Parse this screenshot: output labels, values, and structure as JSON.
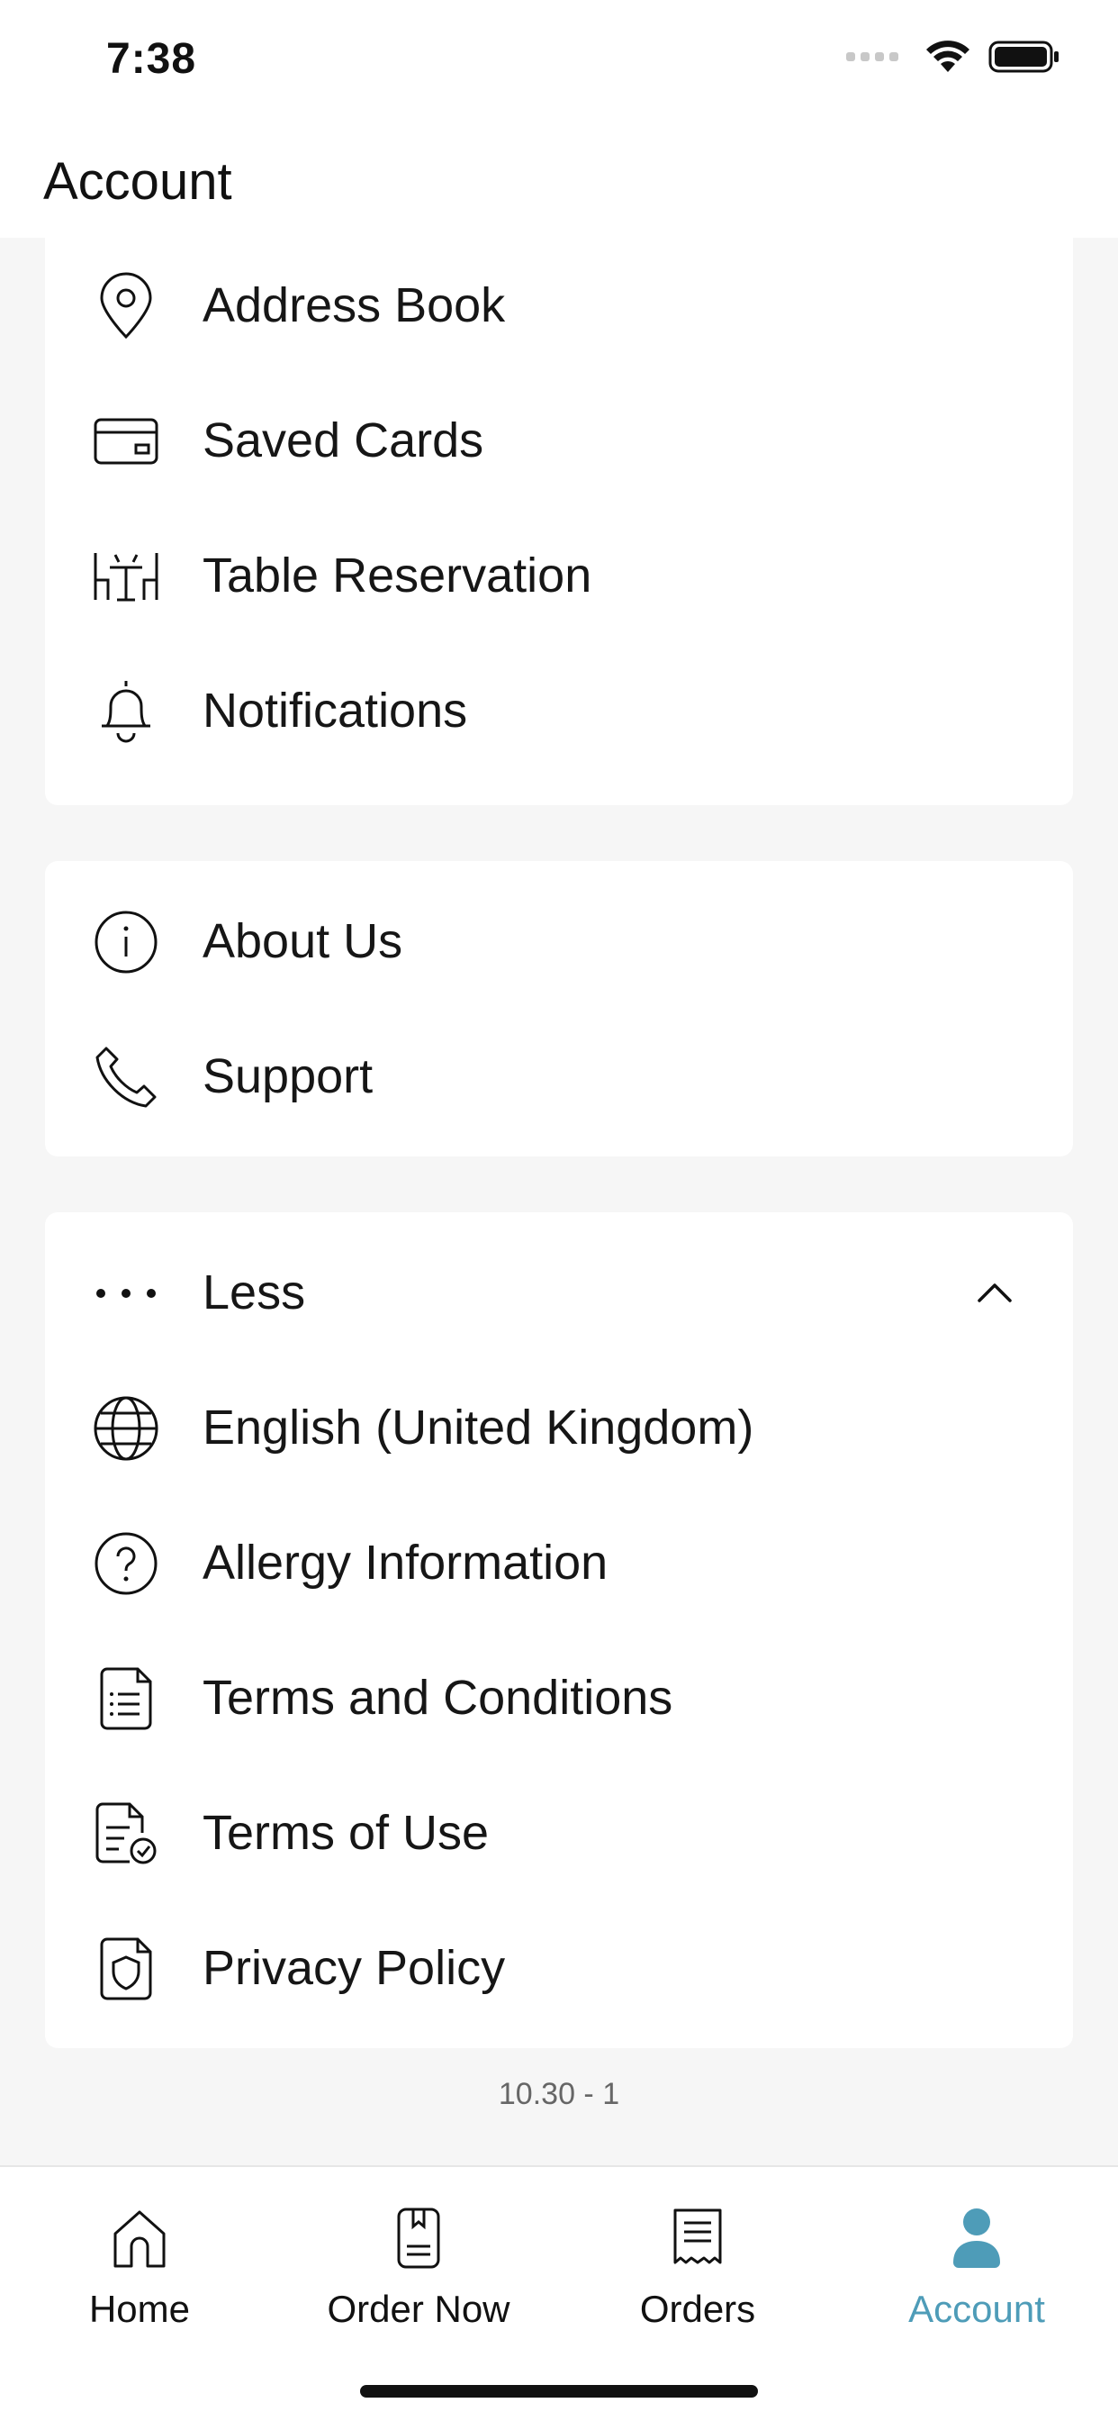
{
  "status_bar": {
    "time": "7:38"
  },
  "header": {
    "title": "Account"
  },
  "account_section": {
    "items": [
      {
        "label": "Address Book",
        "icon": "location-pin-icon"
      },
      {
        "label": "Saved Cards",
        "icon": "credit-card-icon"
      },
      {
        "label": "Table Reservation",
        "icon": "table-chairs-icon"
      },
      {
        "label": "Notifications",
        "icon": "bell-icon"
      }
    ]
  },
  "info_section": {
    "items": [
      {
        "label": "About Us",
        "icon": "info-icon"
      },
      {
        "label": "Support",
        "icon": "phone-icon"
      }
    ]
  },
  "more_section": {
    "toggle_label": "Less",
    "toggle_icon": "more-dots-icon",
    "items": [
      {
        "label": "English (United Kingdom)",
        "icon": "globe-icon"
      },
      {
        "label": "Allergy Information",
        "icon": "question-icon"
      },
      {
        "label": "Terms and Conditions",
        "icon": "document-list-icon"
      },
      {
        "label": "Terms of Use",
        "icon": "document-check-icon"
      },
      {
        "label": "Privacy Policy",
        "icon": "shield-document-icon"
      }
    ]
  },
  "version": "10.30 - 1",
  "tabbar": {
    "tabs": [
      {
        "label": "Home",
        "icon": "home-icon",
        "active": false
      },
      {
        "label": "Order Now",
        "icon": "menu-book-icon",
        "active": false
      },
      {
        "label": "Orders",
        "icon": "receipt-icon",
        "active": false
      },
      {
        "label": "Account",
        "icon": "user-icon",
        "active": true
      }
    ]
  },
  "colors": {
    "accent": "#4e9cb8",
    "background": "#f6f6f6",
    "card": "#ffffff"
  }
}
